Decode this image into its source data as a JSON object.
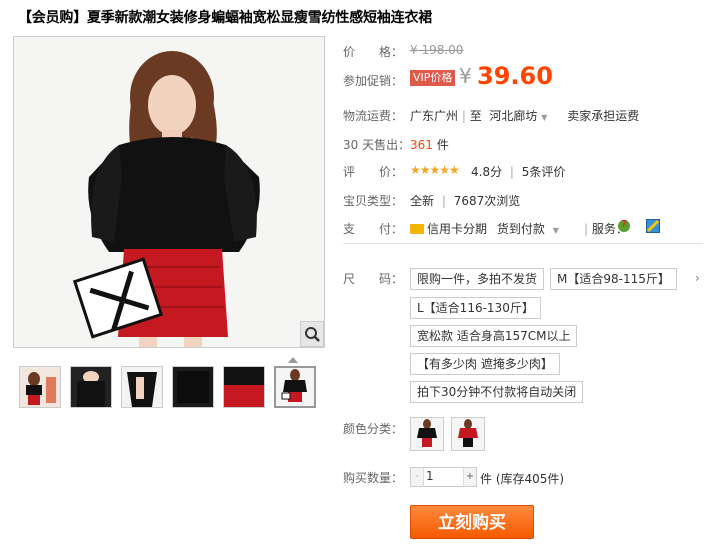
{
  "title": "【会员购】夏季新款潮女装修身蝙蝠袖宽松显瘦雪纺性感短袖连衣裙",
  "price": {
    "label": "价　　格：",
    "original": "¥ 198.00"
  },
  "promo": {
    "label": "参加促销：",
    "tag": "VIP价格",
    "yen": "¥",
    "price": "39.60"
  },
  "shipping": {
    "label": "物流运费：",
    "from": "广东广州",
    "sep": "至",
    "to": "河北廊坊",
    "fee": "卖家承担运费"
  },
  "sales": {
    "label": "30 天售出：",
    "count": "361",
    "unit": "件"
  },
  "rating": {
    "label": "评　　价：",
    "stars": "★★★★★",
    "score": "4.8分",
    "reviews": "5条评价"
  },
  "item_type": {
    "label": "宝贝类型：",
    "condition": "全新",
    "views": "7687次浏览"
  },
  "payment": {
    "label": "支　　付：",
    "credit": "信用卡分期",
    "cod": "货到付款",
    "service_label": "服务："
  },
  "size": {
    "label": "尺　　码：",
    "options": [
      "限购一件，多拍不发货",
      "M【适合98-115斤】",
      "L【适合116-130斤】",
      "宽松款 适合身高157CM以上",
      "【有多少肉 遮掩多少肉】",
      "拍下30分钟不付款将自动关闭"
    ]
  },
  "color": {
    "label": "颜色分类："
  },
  "quantity": {
    "label": "购买数量：",
    "minus": "-",
    "value": "1",
    "plus": "+",
    "stock": "件 (库存405件)"
  },
  "buy_button": "立刻购买",
  "colors": {
    "accent": "#ff4400",
    "buy_button": "#f55a00",
    "vip_tag": "#e05a4a",
    "stars": "#f5a623"
  }
}
